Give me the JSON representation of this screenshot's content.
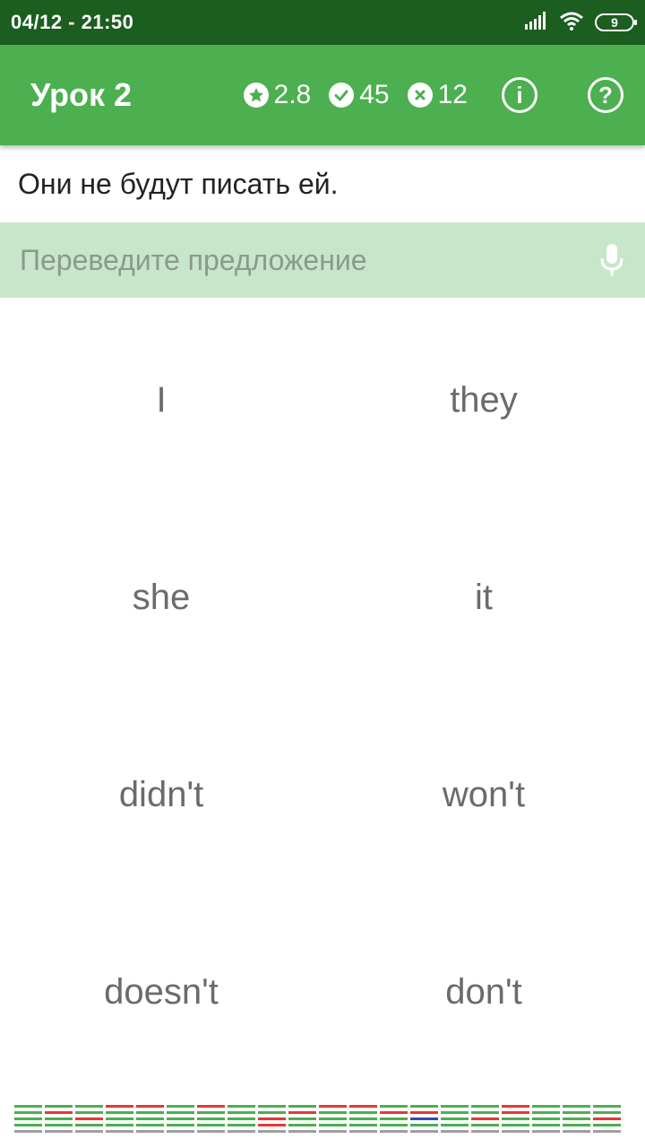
{
  "status_bar": {
    "time": "04/12 - 21:50",
    "battery": "9",
    "icons": [
      "signal-icon",
      "wifi-icon",
      "battery-icon"
    ]
  },
  "app_bar": {
    "title": "Урок 2",
    "stats": {
      "rating": "2.8",
      "correct": "45",
      "wrong": "12"
    },
    "info_label": "i",
    "help_label": "?"
  },
  "exercise": {
    "sentence": "Они не будут писать ей.",
    "input_value": "",
    "input_placeholder": "Переведите предложение"
  },
  "words": [
    "I",
    "they",
    "she",
    "it",
    "didn't",
    "won't",
    "doesn't",
    "don't"
  ],
  "colors": {
    "status_bar": "#1b5e20",
    "app_bar": "#4caf50",
    "input_bg": "#c8e6c9",
    "word_text": "#6b6b6b",
    "progress_green": "#4caf50",
    "progress_red": "#e53935",
    "progress_blue": "#3949ab",
    "progress_gray": "#9e9e9e"
  },
  "progress_grid": [
    [
      "g",
      "g",
      "g",
      "g"
    ],
    [
      "g",
      "r",
      "g",
      "g"
    ],
    [
      "g",
      "g",
      "r",
      "g"
    ],
    [
      "r",
      "g",
      "g",
      "g"
    ],
    [
      "r",
      "g",
      "g",
      "g"
    ],
    [
      "g",
      "g",
      "g",
      "g"
    ],
    [
      "r",
      "g",
      "g",
      "g"
    ],
    [
      "g",
      "g",
      "g",
      "g"
    ],
    [
      "g",
      "g",
      "r",
      "r"
    ],
    [
      "g",
      "r",
      "g",
      "g"
    ],
    [
      "r",
      "g",
      "g",
      "g"
    ],
    [
      "r",
      "g",
      "g",
      "g"
    ],
    [
      "g",
      "r",
      "g",
      "g"
    ],
    [
      "g",
      "r",
      "b",
      "g"
    ],
    [
      "g",
      "g",
      "g",
      "g"
    ],
    [
      "g",
      "g",
      "r",
      "g"
    ],
    [
      "r",
      "r",
      "g",
      "g"
    ],
    [
      "g",
      "g",
      "g",
      "g"
    ],
    [
      "g",
      "g",
      "g",
      "g"
    ],
    [
      "g",
      "g",
      "r",
      "g"
    ]
  ]
}
